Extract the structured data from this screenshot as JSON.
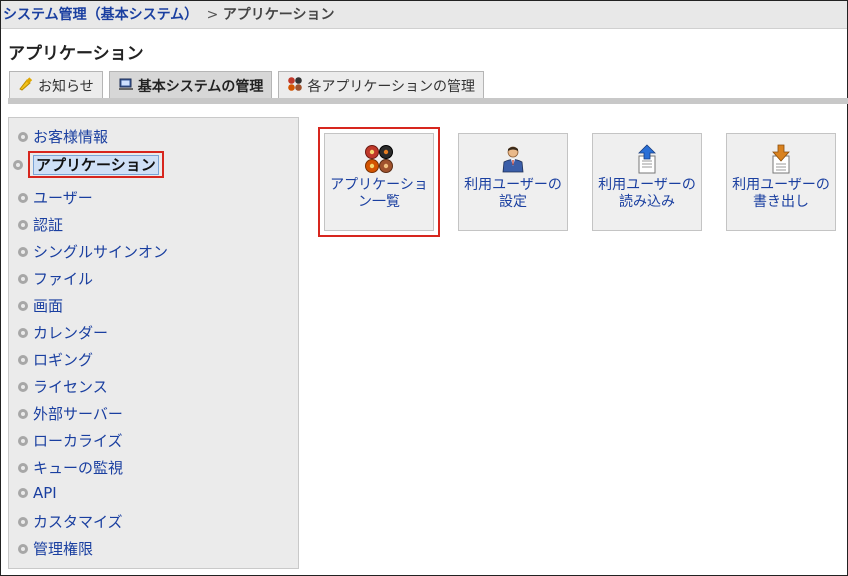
{
  "breadcrumb": {
    "parent": "システム管理（基本システム）",
    "separator": ">",
    "current": "アプリケーション"
  },
  "page_title": "アプリケーション",
  "tabs": [
    {
      "label": "お知らせ",
      "icon": "announcement-icon",
      "active": false
    },
    {
      "label": "基本システムの管理",
      "icon": "computer-icon",
      "active": true
    },
    {
      "label": "各アプリケーションの管理",
      "icon": "applications-icon",
      "active": false
    }
  ],
  "sidebar": {
    "items": [
      {
        "label": "お客様情報"
      },
      {
        "label": "アプリケーション",
        "selected": true
      },
      {
        "label": "ユーザー"
      },
      {
        "label": "認証"
      },
      {
        "label": "シングルサインオン"
      },
      {
        "label": "ファイル"
      },
      {
        "label": "画面"
      },
      {
        "label": "カレンダー"
      },
      {
        "label": "ロギング"
      },
      {
        "label": "ライセンス"
      },
      {
        "label": "外部サーバー"
      },
      {
        "label": "ローカライズ"
      },
      {
        "label": "キューの監視"
      },
      {
        "label": "API"
      },
      {
        "label": "カスタマイズ"
      },
      {
        "label": "管理権限"
      }
    ]
  },
  "tiles": [
    {
      "line1": "アプリケーショ",
      "line2": "ン一覧",
      "icon": "app-list-icon",
      "highlighted": true
    },
    {
      "line1": "利用ユーザーの",
      "line2": "設定",
      "icon": "user-person-icon"
    },
    {
      "line1": "利用ユーザーの",
      "line2": "読み込み",
      "icon": "upload-document-icon"
    },
    {
      "line1": "利用ユーザーの",
      "line2": "書き出し",
      "icon": "download-document-icon"
    }
  ],
  "colors": {
    "link": "#1a3fa0",
    "highlight_border": "#d7261e",
    "selected_bg": "#cfe0f6"
  }
}
